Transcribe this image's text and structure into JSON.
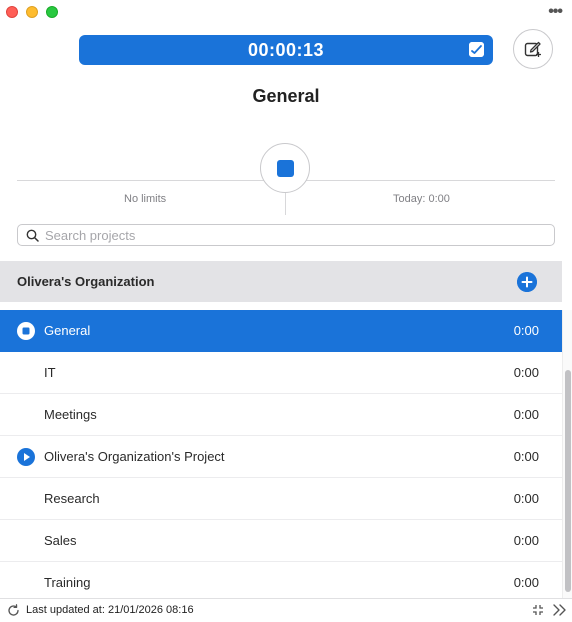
{
  "window": {
    "more_label": "•••"
  },
  "timer": {
    "elapsed": "00:00:13"
  },
  "current_project": {
    "title": "General"
  },
  "limits": {
    "left_label": "No limits",
    "right_label": "Today: 0:00"
  },
  "search": {
    "placeholder": "Search projects",
    "value": ""
  },
  "organization": {
    "name": "Olivera's Organization"
  },
  "projects": [
    {
      "name": "General",
      "time": "0:00",
      "state": "active"
    },
    {
      "name": "IT",
      "time": "0:00",
      "state": "idle"
    },
    {
      "name": "Meetings",
      "time": "0:00",
      "state": "idle"
    },
    {
      "name": "Olivera's Organization's Project",
      "time": "0:00",
      "state": "play"
    },
    {
      "name": "Research",
      "time": "0:00",
      "state": "idle"
    },
    {
      "name": "Sales",
      "time": "0:00",
      "state": "idle"
    },
    {
      "name": "Training",
      "time": "0:00",
      "state": "idle"
    }
  ],
  "footer": {
    "last_updated": "Last updated at: 21/01/2026 08:16"
  },
  "colors": {
    "accent": "#1a73d9",
    "header_bg": "#e3e3e6"
  }
}
